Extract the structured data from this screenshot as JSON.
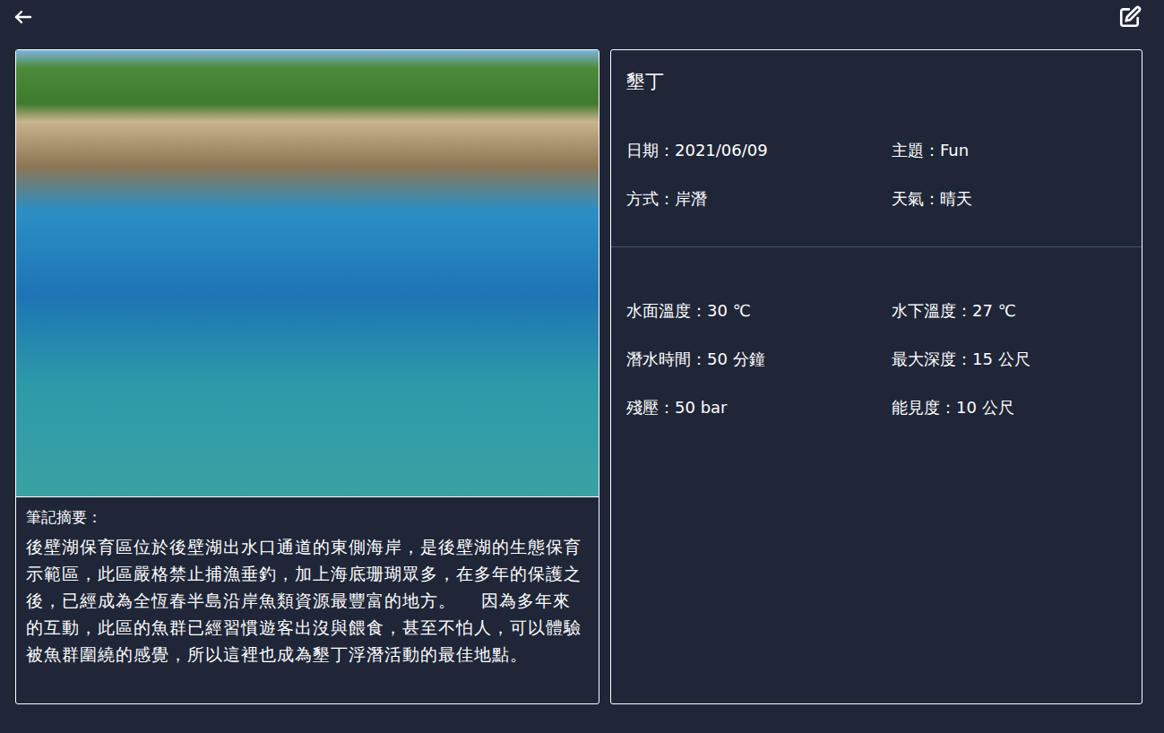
{
  "header": {
    "title": "墾丁"
  },
  "info": [
    "日期：2021/06/09",
    "主題：Fun",
    "方式：岸潛",
    "天氣：晴天"
  ],
  "stats": [
    "水面溫度：30 ℃",
    "水下溫度：27 ℃",
    "潛水時間：50 分鐘",
    "最大深度：15 公尺",
    "殘壓：50 bar",
    "能見度：10 公尺"
  ],
  "notes": {
    "label": "筆記摘要：",
    "text": "後壁湖保育區位於後壁湖出水口通道的東側海岸，是後壁湖的生態保育示範區，此區嚴格禁止捕漁垂釣，加上海底珊瑚眾多，在多年的保護之後，已經成為全恆春半島沿岸魚類資源最豐富的地方。    因為多年來的互動，此區的魚群已經習慣遊客出沒與餵食，甚至不怕人，可以體驗被魚群圍繞的感覺，所以這裡也成為墾丁浮潛活動的最佳地點。"
  }
}
